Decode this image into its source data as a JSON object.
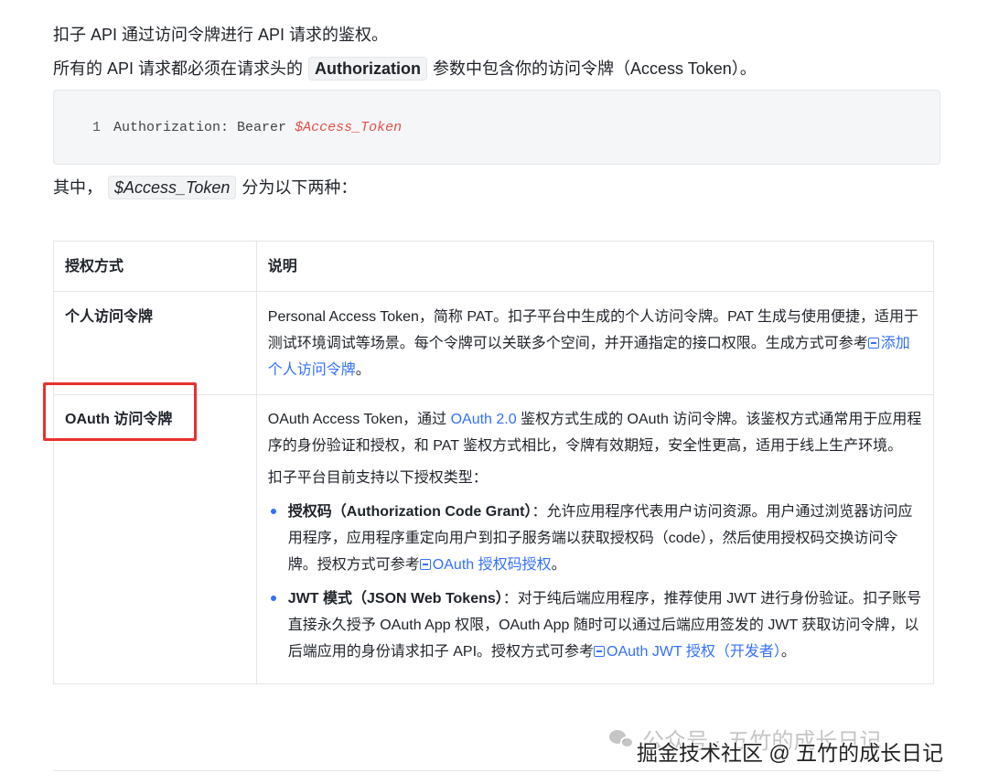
{
  "intro": {
    "line1": "扣子 API 通过访问令牌进行 API 请求的鉴权。",
    "line2_before": "所有的 API 请求都必须在请求头的",
    "line2_code": "Authorization",
    "line2_after": "参数中包含你的访问令牌（Access Token）。"
  },
  "code_block": {
    "line_number": "1",
    "text": "Authorization: Bearer ",
    "variable": "$Access_Token"
  },
  "note": {
    "before": "其中，",
    "code": "$Access_Token",
    "after": "分为以下两种："
  },
  "table": {
    "headers": [
      "授权方式",
      "说明"
    ],
    "rows": [
      {
        "method": "个人访问令牌",
        "desc_text": "Personal Access Token，简称 PAT。扣子平台中生成的个人访问令牌。PAT 生成与使用便捷，适用于测试环境调试等场景。每个令牌可以关联多个空间，并开通指定的接口权限。生成方式可参考",
        "desc_link": "添加个人访问令牌",
        "desc_end": "。"
      },
      {
        "method": "OAuth 访问令牌",
        "desc_before": "OAuth Access Token，通过 ",
        "desc_link": "OAuth 2.0",
        "desc_after": " 鉴权方式生成的 OAuth 访问令牌。该鉴权方式通常用于应用程序的身份验证和授权，和 PAT 鉴权方式相比，令牌有效期短，安全性更高，适用于线上生产环境。",
        "support_text": "扣子平台目前支持以下授权类型：",
        "types": [
          {
            "name": "授权码（Authorization Code Grant）",
            "text": "：允许应用程序代表用户访问资源。用户通过浏览器访问应用程序，应用程序重定向用户到扣子服务端以获取授权码（code），然后使用授权码交换访问令牌。授权方式可参考",
            "link": "OAuth 授权码授权",
            "end": "。"
          },
          {
            "name": "JWT 模式（JSON Web Tokens）",
            "text": "：对于纯后端应用程序，推荐使用 JWT 进行身份验证。扣子账号直接永久授予 OAuth App 权限，OAuth App 随时可以通过后端应用签发的 JWT 获取访问令牌，以后端应用的身份请求扣子 API。授权方式可参考",
            "link": "OAuth JWT 授权（开发者）",
            "end": "。"
          }
        ]
      }
    ]
  },
  "watermarks": {
    "wechat": "公众号 · 五竹的成长日记",
    "juejin": "掘金技术社区 @ 五竹的成长日记"
  },
  "colors": {
    "link": "#3370ff",
    "highlight_border": "#e8312f",
    "code_variable": "#e0504c"
  }
}
